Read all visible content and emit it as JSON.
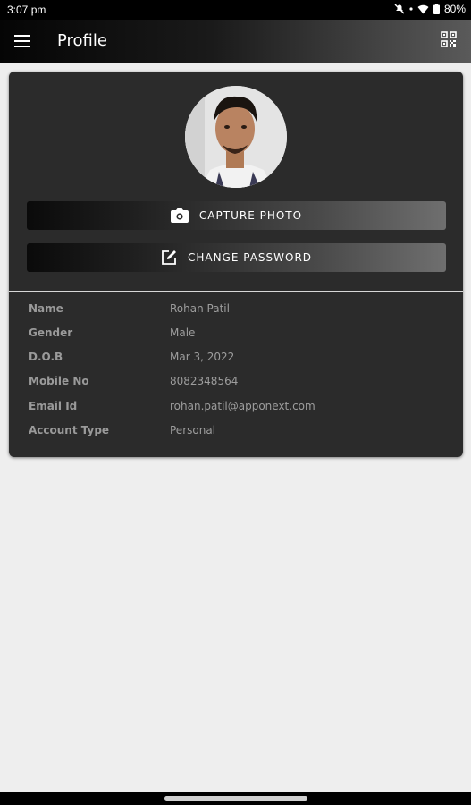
{
  "status_bar": {
    "time": "3:07 pm",
    "battery": "80%"
  },
  "app_bar": {
    "title": "Profile"
  },
  "profile": {
    "capture_label": "CAPTURE PHOTO",
    "password_label": "CHANGE PASSWORD",
    "fields": [
      {
        "label": "Name",
        "value": "Rohan Patil"
      },
      {
        "label": "Gender",
        "value": "Male"
      },
      {
        "label": "D.O.B",
        "value": "Mar 3, 2022"
      },
      {
        "label": "Mobile No",
        "value": "8082348564"
      },
      {
        "label": "Email Id",
        "value": "rohan.patil@apponext.com"
      },
      {
        "label": "Account Type",
        "value": "Personal"
      }
    ]
  },
  "colors": {
    "app_bar_dark": "#050505",
    "card_bg": "#2b2b2b",
    "page_bg": "#eeeeee"
  },
  "icons": [
    "menu-icon",
    "qr-code-icon",
    "camera-icon",
    "edit-icon",
    "mute-icon",
    "wifi-icon",
    "battery-icon"
  ]
}
